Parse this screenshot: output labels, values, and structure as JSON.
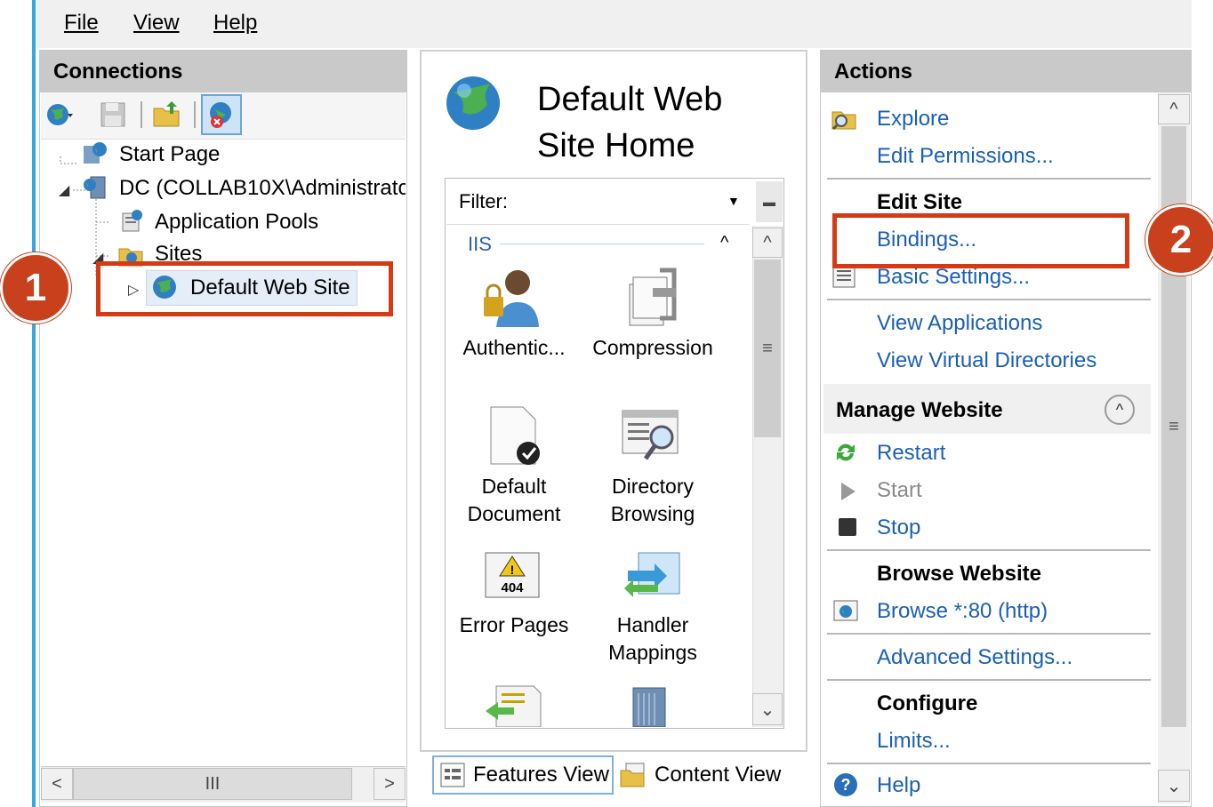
{
  "menu": {
    "file": "File",
    "view": "View",
    "help": "Help"
  },
  "connections": {
    "title": "Connections",
    "tree": {
      "start_page": "Start Page",
      "server": "DC (COLLAB10X\\Administrato",
      "app_pools": "Application Pools",
      "sites": "Sites",
      "default_site": "Default Web Site"
    },
    "scroll_mid": "III"
  },
  "home": {
    "title": "Default Web Site Home",
    "filter_label": "Filter:",
    "group_label": "IIS",
    "features": [
      {
        "label": "Authentic...",
        "icon": "user-lock-icon"
      },
      {
        "label": "Compression",
        "icon": "compression-icon"
      },
      {
        "label": "Default Document",
        "icon": "default-document-icon"
      },
      {
        "label": "Directory Browsing",
        "icon": "directory-browsing-icon"
      },
      {
        "label": "Error Pages",
        "icon": "error-404-icon"
      },
      {
        "label": "Handler Mappings",
        "icon": "handler-mappings-icon"
      }
    ],
    "view_tabs": {
      "features": "Features View",
      "content": "Content View"
    }
  },
  "actions": {
    "title": "Actions",
    "explore": "Explore",
    "edit_permissions": "Edit Permissions...",
    "edit_site": "Edit Site",
    "bindings": "Bindings...",
    "basic_settings": "Basic Settings...",
    "view_applications": "View Applications",
    "view_virtual_dirs": "View Virtual Directories",
    "manage_website": "Manage Website",
    "restart": "Restart",
    "start": "Start",
    "stop": "Stop",
    "browse_website": "Browse Website",
    "browse_80": "Browse *:80 (http)",
    "advanced_settings": "Advanced Settings...",
    "configure": "Configure",
    "limits": "Limits...",
    "help": "Help"
  },
  "callouts": {
    "one": "1",
    "two": "2"
  },
  "colors": {
    "accent": "#35a8e0",
    "link": "#1a5fb4",
    "callout": "#d43a14"
  }
}
